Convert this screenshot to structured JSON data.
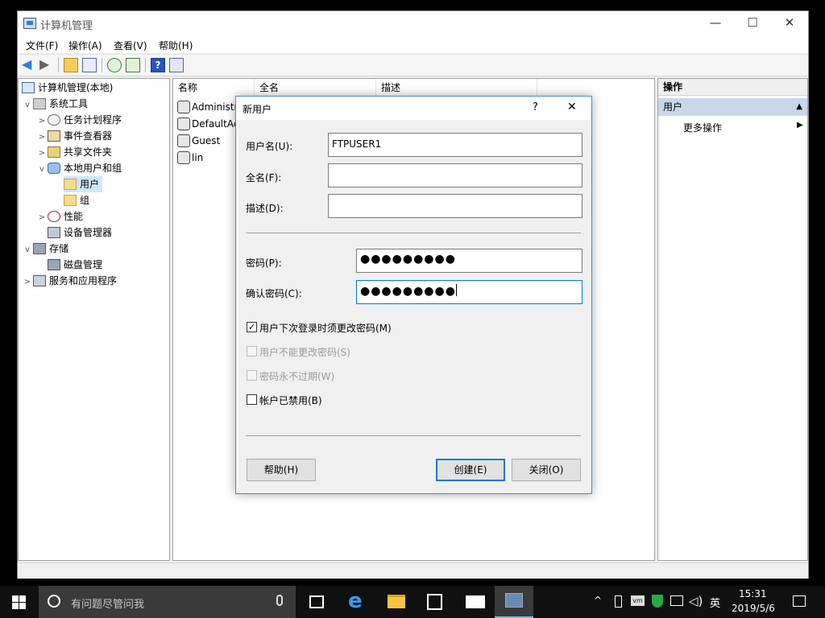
{
  "window": {
    "title": "计算机管理",
    "menu": [
      "文件(F)",
      "操作(A)",
      "查看(V)",
      "帮助(H)"
    ],
    "controls": {
      "minimize": "—",
      "maximize": "☐",
      "close": "✕"
    }
  },
  "tree": {
    "root": "计算机管理(本地)",
    "system_tools": "系统工具",
    "task_scheduler": "任务计划程序",
    "event_viewer": "事件查看器",
    "shared_folders": "共享文件夹",
    "local_users_groups": "本地用户和组",
    "users": "用户",
    "groups": "组",
    "performance": "性能",
    "device_manager": "设备管理器",
    "storage": "存储",
    "disk_management": "磁盘管理",
    "services_apps": "服务和应用程序"
  },
  "list": {
    "columns": [
      "名称",
      "全名",
      "描述"
    ],
    "rows": [
      "Administr",
      "DefaultAc",
      "Guest",
      "lin"
    ]
  },
  "actions": {
    "header": "操作",
    "section": "用户",
    "more": "更多操作"
  },
  "dialog": {
    "title": "新用户",
    "help_glyph": "?",
    "close_glyph": "✕",
    "username_label": "用户名(U):",
    "username_value": "FTPUSER1",
    "fullname_label": "全名(F):",
    "fullname_value": "",
    "description_label": "描述(D):",
    "description_value": "",
    "password_label": "密码(P):",
    "password_value": "●●●●●●●●●",
    "confirm_label": "确认密码(C):",
    "confirm_value": "●●●●●●●●●",
    "check_must_change": {
      "label": "用户下次登录时须更改密码(M)",
      "checked": true,
      "enabled": true
    },
    "check_cannot_change": {
      "label": "用户不能更改密码(S)",
      "checked": false,
      "enabled": false
    },
    "check_never_expires": {
      "label": "密码永不过期(W)",
      "checked": false,
      "enabled": false
    },
    "check_disabled": {
      "label": "帐户已禁用(B)",
      "checked": false,
      "enabled": true
    },
    "help_button": "帮助(H)",
    "create_button": "创建(E)",
    "close_button": "关闭(O)"
  },
  "taskbar": {
    "search_placeholder": "有问题尽管问我",
    "time": "15:31",
    "date": "2019/5/6",
    "ime": "英"
  }
}
